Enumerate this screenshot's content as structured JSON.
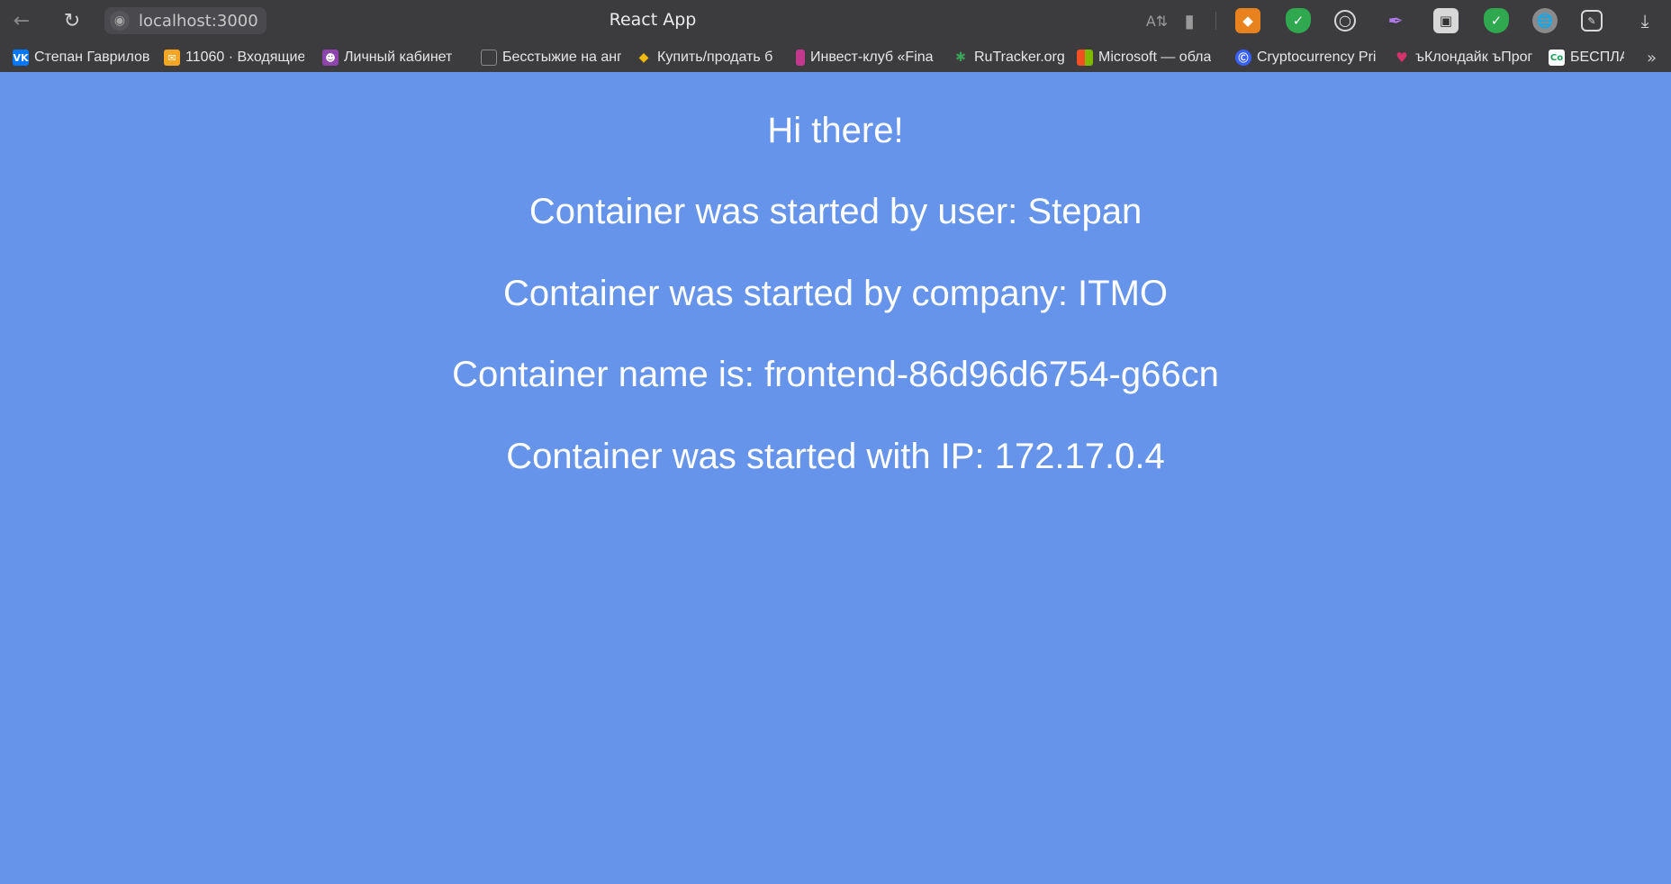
{
  "browser": {
    "url": "localhost:3000",
    "page_title": "React App"
  },
  "bookmarks": [
    {
      "label": "Степан Гаврилов",
      "icon": "vk-icon",
      "color": "#0077ff"
    },
    {
      "label": "11060 · Входящие",
      "icon": "mail-icon",
      "color": "#f5a623"
    },
    {
      "label": "Личный кабинет",
      "icon": "person-icon",
      "color": "#8e44ad"
    },
    {
      "label": "Бесстыжие на анг",
      "icon": "document-icon",
      "color": "#9a9a9a"
    },
    {
      "label": "Купить/продать б",
      "icon": "binance-icon",
      "color": "#f0b90b"
    },
    {
      "label": "Инвест-клуб «Fina",
      "icon": "tie-icon",
      "color": "#c0398c"
    },
    {
      "label": "RuTracker.org",
      "icon": "rutracker-icon",
      "color": "#3aa55a"
    },
    {
      "label": "Microsoft — обла",
      "icon": "microsoft-icon",
      "color": "#f25022"
    },
    {
      "label": "Cryptocurrency Pri",
      "icon": "coinmarketcap-icon",
      "color": "#3861fb"
    },
    {
      "label": "ъКлондайк ъПрог",
      "icon": "heart-gem-icon",
      "color": "#d6336c"
    },
    {
      "label": "БЕСПЛА",
      "icon": "co-icon",
      "color": "#1b9e5a"
    }
  ],
  "content": {
    "greeting": "Hi there!",
    "user_line": "Container was started by user: Stepan",
    "company_line": "Container was started by company: ITMO",
    "name_line": "Container name is: frontend-86d96d6754-g66cn",
    "ip_line": "Container was started with IP: 172.17.0.4"
  },
  "colors": {
    "page_background": "#6594ea",
    "text": "#ffffff",
    "browser_chrome": "#3c3c3f"
  }
}
